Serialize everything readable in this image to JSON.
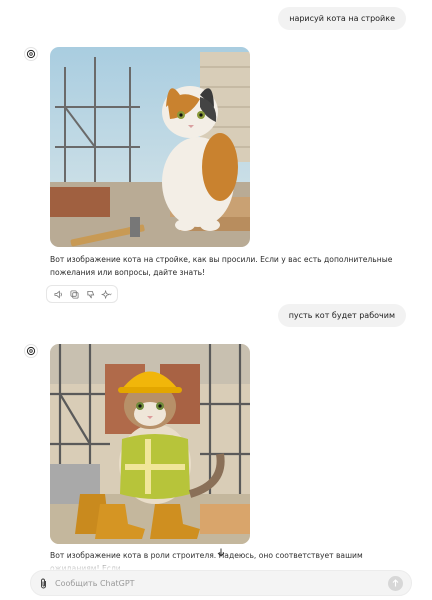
{
  "messages": {
    "user_1": "нарисуй кота на стройке",
    "bot_1": "Вот изображение кота на стройке, как вы просили. Если у вас есть дополнительные пожелания или вопросы, дайте знать!",
    "user_2": "пусть кот будет рабочим",
    "bot_2": "Вот изображение кота в роли строителя. Надеюсь, оно соответствует вашим ожиданиям! Если"
  },
  "actions": [
    "speaker-icon",
    "copy-icon",
    "thumbs-down-icon",
    "regenerate-icon"
  ],
  "composer": {
    "placeholder": "Сообщить ChatGPT"
  },
  "colors": {
    "bubble": "#f2f2f2",
    "composer": "#f4f4f4",
    "send_button": "#d7d7d7"
  }
}
